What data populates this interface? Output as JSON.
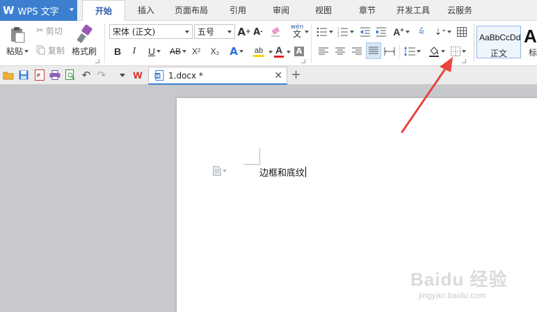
{
  "app": {
    "title": "WPS 文字",
    "logo": "W"
  },
  "menu": {
    "tabs": [
      {
        "label": "开始",
        "active": true
      },
      {
        "label": "插入"
      },
      {
        "label": "页面布局"
      },
      {
        "label": "引用"
      },
      {
        "label": "审阅"
      },
      {
        "label": "视图"
      },
      {
        "label": "章节"
      },
      {
        "label": "开发工具"
      },
      {
        "label": "云服务"
      }
    ]
  },
  "ribbon": {
    "clipboard": {
      "paste": "粘贴",
      "cut": "剪切",
      "copy": "复制",
      "format_painter": "格式刷"
    },
    "font": {
      "family": "宋体 (正文)",
      "size": "五号",
      "bold": "B",
      "italic": "I",
      "underline": "U",
      "strike": "AB",
      "superscript": "X²",
      "subscript": "X₂",
      "font_color_letter": "A",
      "highlight_letter": "ab",
      "grow": "A⁺",
      "shrink": "A⁻",
      "phonetic": "wén 文"
    },
    "styles": {
      "preview_1": "AaBbCcDd",
      "name_1": "正文",
      "preview_2": "Aa",
      "name_2": "标"
    }
  },
  "document": {
    "filename": "1.docx *",
    "text": "边框和底纹"
  },
  "watermark": {
    "brand": "Baidu 经验",
    "url": "jingyan.baidu.com"
  },
  "colors": {
    "accent": "#3d7fcf",
    "arrow": "#e8453c",
    "font_color_bar": "#e02020",
    "highlight_bar": "#ffd400"
  }
}
